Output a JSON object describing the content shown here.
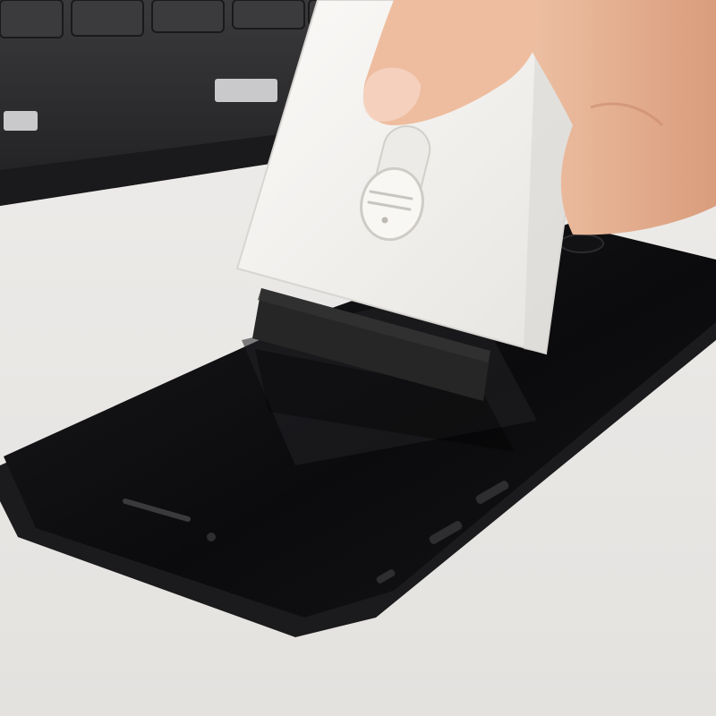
{
  "scene": {
    "subject": "screen-cleaner-tool-on-smartphone",
    "colors": {
      "desk": "#e9e7e5",
      "keyboard": "#2b2b2d",
      "keycap": "#3a3a3d",
      "phone_body": "#1b1b1d",
      "phone_screen": "#0e0e10",
      "cleaner_body": "#f4f3f0",
      "cleaner_pad": "#2a2a2a",
      "skin": "#e8b496"
    }
  }
}
